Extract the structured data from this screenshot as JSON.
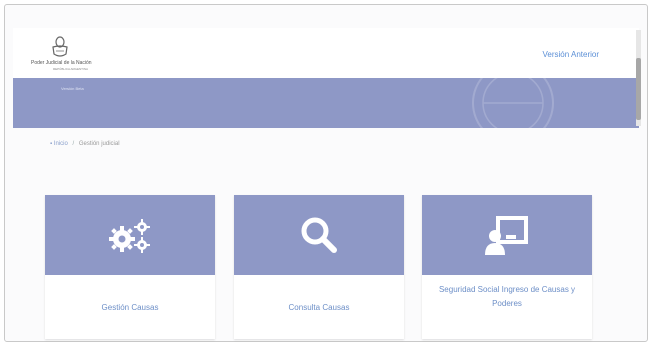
{
  "header": {
    "brand": "Poder Judicial de la Nación",
    "brand_sub": "REPÚBLICA ARGENTINA",
    "version_link": "Versión Anterior"
  },
  "banner": {
    "text": "Versión Beta"
  },
  "breadcrumb": {
    "home": "Inicio",
    "separator": "/",
    "current": "Gestión judicial"
  },
  "cards": [
    {
      "label": "Gestión Causas",
      "icon": "gears-icon"
    },
    {
      "label": "Consulta Causas",
      "icon": "search-icon"
    },
    {
      "label": "Seguridad Social Ingreso de Causas y Poderes",
      "icon": "user-screen-icon"
    }
  ],
  "colors": {
    "primary": "#8e98c6",
    "link": "#5b8fd6",
    "card_text": "#6d8fc7"
  }
}
